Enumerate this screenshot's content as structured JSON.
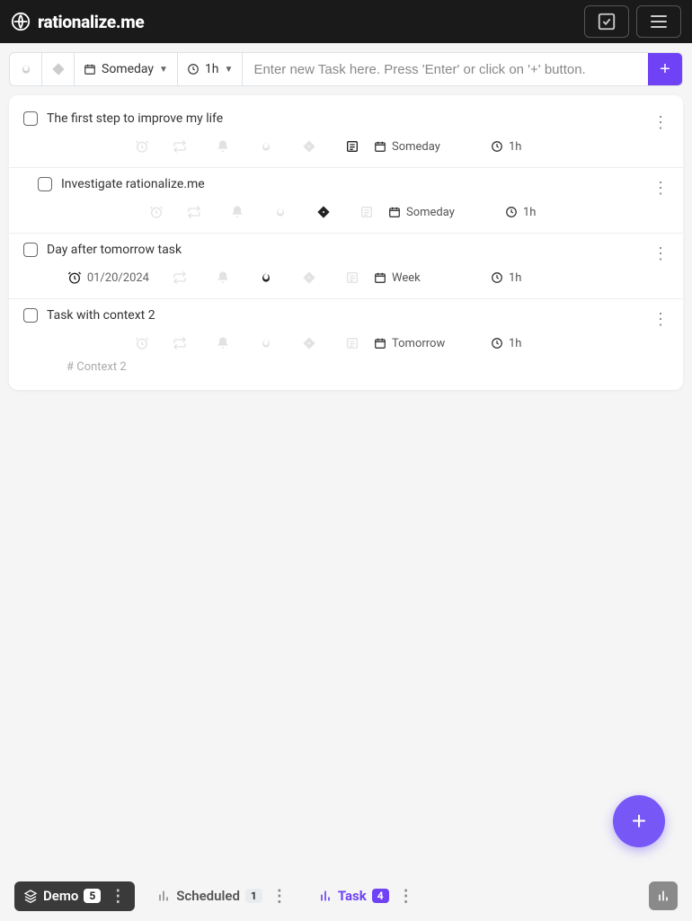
{
  "header": {
    "brand": "rationalize.me"
  },
  "toolbar": {
    "schedule_label": "Someday",
    "duration_label": "1h",
    "input_placeholder": "Enter new Task here. Press 'Enter' or click on '+' button.",
    "add_label": "+"
  },
  "tasks": [
    {
      "title": "The first step to improve my life",
      "indented": false,
      "date_text": "",
      "has_note": true,
      "priority_active": false,
      "fire_active": false,
      "schedule": "Someday",
      "duration": "1h",
      "context": ""
    },
    {
      "title": "Investigate rationalize.me",
      "indented": true,
      "date_text": "",
      "has_note": false,
      "priority_active": true,
      "fire_active": false,
      "schedule": "Someday",
      "duration": "1h",
      "context": ""
    },
    {
      "title": "Day after tomorrow task",
      "indented": false,
      "date_text": "01/20/2024",
      "has_note": false,
      "priority_active": false,
      "fire_active": true,
      "schedule": "Week",
      "duration": "1h",
      "context": ""
    },
    {
      "title": "Task with context 2",
      "indented": false,
      "date_text": "",
      "has_note": false,
      "priority_active": false,
      "fire_active": false,
      "schedule": "Tomorrow",
      "duration": "1h",
      "context": "# Context 2"
    }
  ],
  "fab": {
    "label": "+"
  },
  "bottom": {
    "demo_label": "Demo",
    "demo_count": "5",
    "scheduled_label": "Scheduled",
    "scheduled_count": "1",
    "task_label": "Task",
    "task_count": "4"
  }
}
